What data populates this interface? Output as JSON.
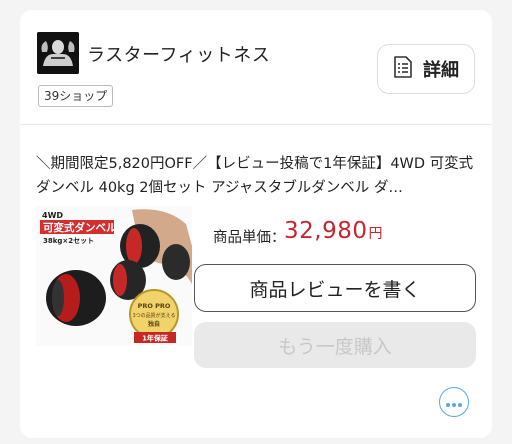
{
  "shop": {
    "name": "ラスターフィットネス",
    "badge": "39ショップ",
    "detail_label": "詳細"
  },
  "product": {
    "title": "＼期間限定5,820円OFF／【レビュー投稿で1年保証】4WD 可変式ダンベル 40kg 2個セット アジャスタブルダンベル ダ…",
    "price_label": "商品単価：",
    "price": "32,980",
    "price_unit": "円",
    "image_text": {
      "brand": "4WD",
      "headline": "可変式ダンベル",
      "sub": "38kg×2セット",
      "seal_top": "PRO PRO",
      "seal_mid": "3つの品質が支える",
      "seal_bottom": "独自",
      "ribbon": "1年保証"
    }
  },
  "actions": {
    "review_label": "商品レビューを書く",
    "rebuy_label": "もう一度購入"
  },
  "icons": {
    "detail": "document-list-icon",
    "more": "more-dots-icon",
    "logo": "shop-logo"
  },
  "colors": {
    "price": "#c6262e",
    "more_accent": "#5aa8e0",
    "disabled_bg": "#e9e9e9"
  }
}
